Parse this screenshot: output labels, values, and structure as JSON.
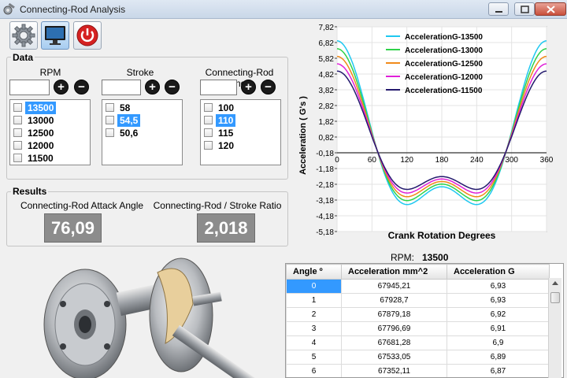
{
  "window": {
    "title": "Connecting-Rod Analysis",
    "controls": [
      "minimize-icon",
      "maximize-icon",
      "close-icon"
    ]
  },
  "toolbar": {
    "buttons": [
      {
        "name": "settings",
        "icon": "gear-icon"
      },
      {
        "name": "display",
        "icon": "monitor-icon",
        "active": true
      },
      {
        "name": "power",
        "icon": "power-icon"
      }
    ]
  },
  "data_section": {
    "legend": "Data",
    "columns": [
      {
        "label": "RPM",
        "input_value": "",
        "items": [
          {
            "label": "13500",
            "selected": true,
            "checked": false
          },
          {
            "label": "13000",
            "selected": false,
            "checked": false
          },
          {
            "label": "12500",
            "selected": false,
            "checked": false
          },
          {
            "label": "12000",
            "selected": false,
            "checked": false
          },
          {
            "label": "11500",
            "selected": false,
            "checked": false
          }
        ]
      },
      {
        "label": "Stroke",
        "input_value": "",
        "items": [
          {
            "label": "58",
            "selected": false,
            "checked": false
          },
          {
            "label": "54,5",
            "selected": true,
            "checked": false
          },
          {
            "label": "50,6",
            "selected": false,
            "checked": false
          }
        ]
      },
      {
        "label": "Connecting-Rod Length",
        "input_value": "",
        "items": [
          {
            "label": "100",
            "selected": false,
            "checked": false
          },
          {
            "label": "110",
            "selected": true,
            "checked": false
          },
          {
            "label": "115",
            "selected": false,
            "checked": false
          },
          {
            "label": "120",
            "selected": false,
            "checked": false
          }
        ]
      }
    ],
    "add_symbol": "+",
    "remove_symbol": "−"
  },
  "results_section": {
    "legend": "Results",
    "attack_angle_label": "Connecting-Rod Attack Angle",
    "attack_angle_value": "76,09",
    "ratio_label": "Connecting-Rod / Stroke Ratio",
    "ratio_value": "2,018"
  },
  "image": {
    "subject": "crankshaft-photo"
  },
  "chart_data": {
    "type": "line",
    "xlabel": "Crank Rotation Degrees",
    "ylabel": "Acceleration ( G's )",
    "xticks": [
      "0",
      "60",
      "120",
      "180",
      "240",
      "300",
      "360"
    ],
    "yticks": [
      "7,82",
      "6,82",
      "5,82",
      "4,82",
      "3,82",
      "2,82",
      "1,82",
      "0,82",
      "-0,18",
      "-1,18",
      "-2,18",
      "-3,18",
      "-4,18",
      "-5,18"
    ],
    "xlim": [
      0,
      360
    ],
    "ylim": [
      -5.18,
      7.82
    ],
    "legend_position": "top-right",
    "grid": true,
    "rod_to_stroke_ratio": 2.018,
    "series": [
      {
        "name": "AccelerationG-13500",
        "color": "#1fc8f0",
        "peak": 6.93
      },
      {
        "name": "AccelerationG-13000",
        "color": "#2fd24a",
        "peak": 6.43
      },
      {
        "name": "AccelerationG-12500",
        "color": "#f08a1a",
        "peak": 5.94
      },
      {
        "name": "AccelerationG-12000",
        "color": "#e020d8",
        "peak": 5.47
      },
      {
        "name": "AccelerationG-11500",
        "color": "#241a6e",
        "peak": 5.01
      }
    ]
  },
  "selection": {
    "rpm_label": "RPM:",
    "rpm_value": "13500"
  },
  "table": {
    "columns": [
      "Angle º",
      "Acceleration mm^2",
      "Acceleration G"
    ],
    "rows": [
      [
        "0",
        "67945,21",
        "6,93"
      ],
      [
        "1",
        "67928,7",
        "6,93"
      ],
      [
        "2",
        "67879,18",
        "6,92"
      ],
      [
        "3",
        "67796,69",
        "6,91"
      ],
      [
        "4",
        "67681,28",
        "6,9"
      ],
      [
        "5",
        "67533,05",
        "6,89"
      ],
      [
        "6",
        "67352,11",
        "6,87"
      ]
    ]
  }
}
